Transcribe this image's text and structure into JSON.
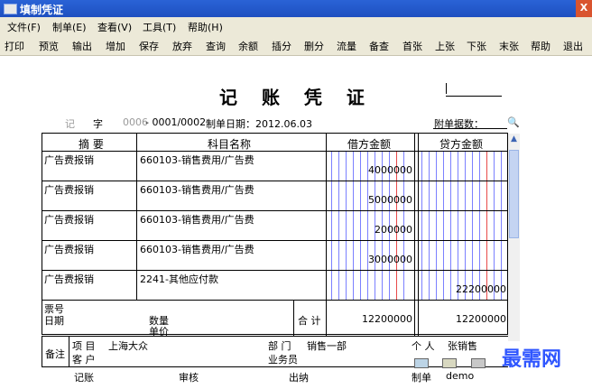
{
  "window": {
    "title": "填制凭证",
    "close_glyph": "X"
  },
  "menu": [
    "文件(F)",
    "制单(E)",
    "查看(V)",
    "工具(T)",
    "帮助(H)"
  ],
  "toolbar": [
    "打印",
    "预览",
    "输出",
    "增加",
    "保存",
    "放弃",
    "查询",
    "余额",
    "插分",
    "删分",
    "流量",
    "备查",
    "首张",
    "上张",
    "下张",
    "末张",
    "帮助",
    "退出"
  ],
  "voucher": {
    "title": "记 账 凭 证",
    "type_char": "记",
    "zi": "字",
    "voucher_no": "0006",
    "page": "- 0001/0002",
    "date_label": "制单日期：2012.06.03",
    "attach_label": "附单据数：",
    "headers": {
      "summary": "摘 要",
      "account": "科目名称",
      "debit": "借方金额",
      "credit": "贷方金额"
    },
    "rows": [
      {
        "summary": "广告费报销",
        "account": "660103-销售费用/广告费",
        "debit": "4000000",
        "credit": ""
      },
      {
        "summary": "广告费报销",
        "account": "660103-销售费用/广告费",
        "debit": "5000000",
        "credit": ""
      },
      {
        "summary": "广告费报销",
        "account": "660103-销售费用/广告费",
        "debit": "200000",
        "credit": ""
      },
      {
        "summary": "广告费报销",
        "account": "660103-销售费用/广告费",
        "debit": "3000000",
        "credit": ""
      },
      {
        "summary": "广告费报销",
        "account": "2241-其他应付款",
        "debit": "",
        "credit": "22200000"
      }
    ],
    "bottom": {
      "ticket_no": "票号",
      "date": "日期",
      "qty": "数量",
      "price": "单价",
      "total_label": "合 计",
      "total_debit": "12200000",
      "total_credit": "12200000"
    },
    "remarks": {
      "label": "备注",
      "project_label": "项 目",
      "project": "上海大众",
      "dept_label": "部 门",
      "dept": "销售一部",
      "person_label": "个 人",
      "person": "张销售",
      "customer_label": "客 户",
      "salesman_label": "业务员"
    },
    "signoff": {
      "bookkeep": "记账",
      "audit": "审核",
      "cashier": "出纳",
      "maker": "制单",
      "maker_name": "demo"
    }
  },
  "watermark": "最需网"
}
